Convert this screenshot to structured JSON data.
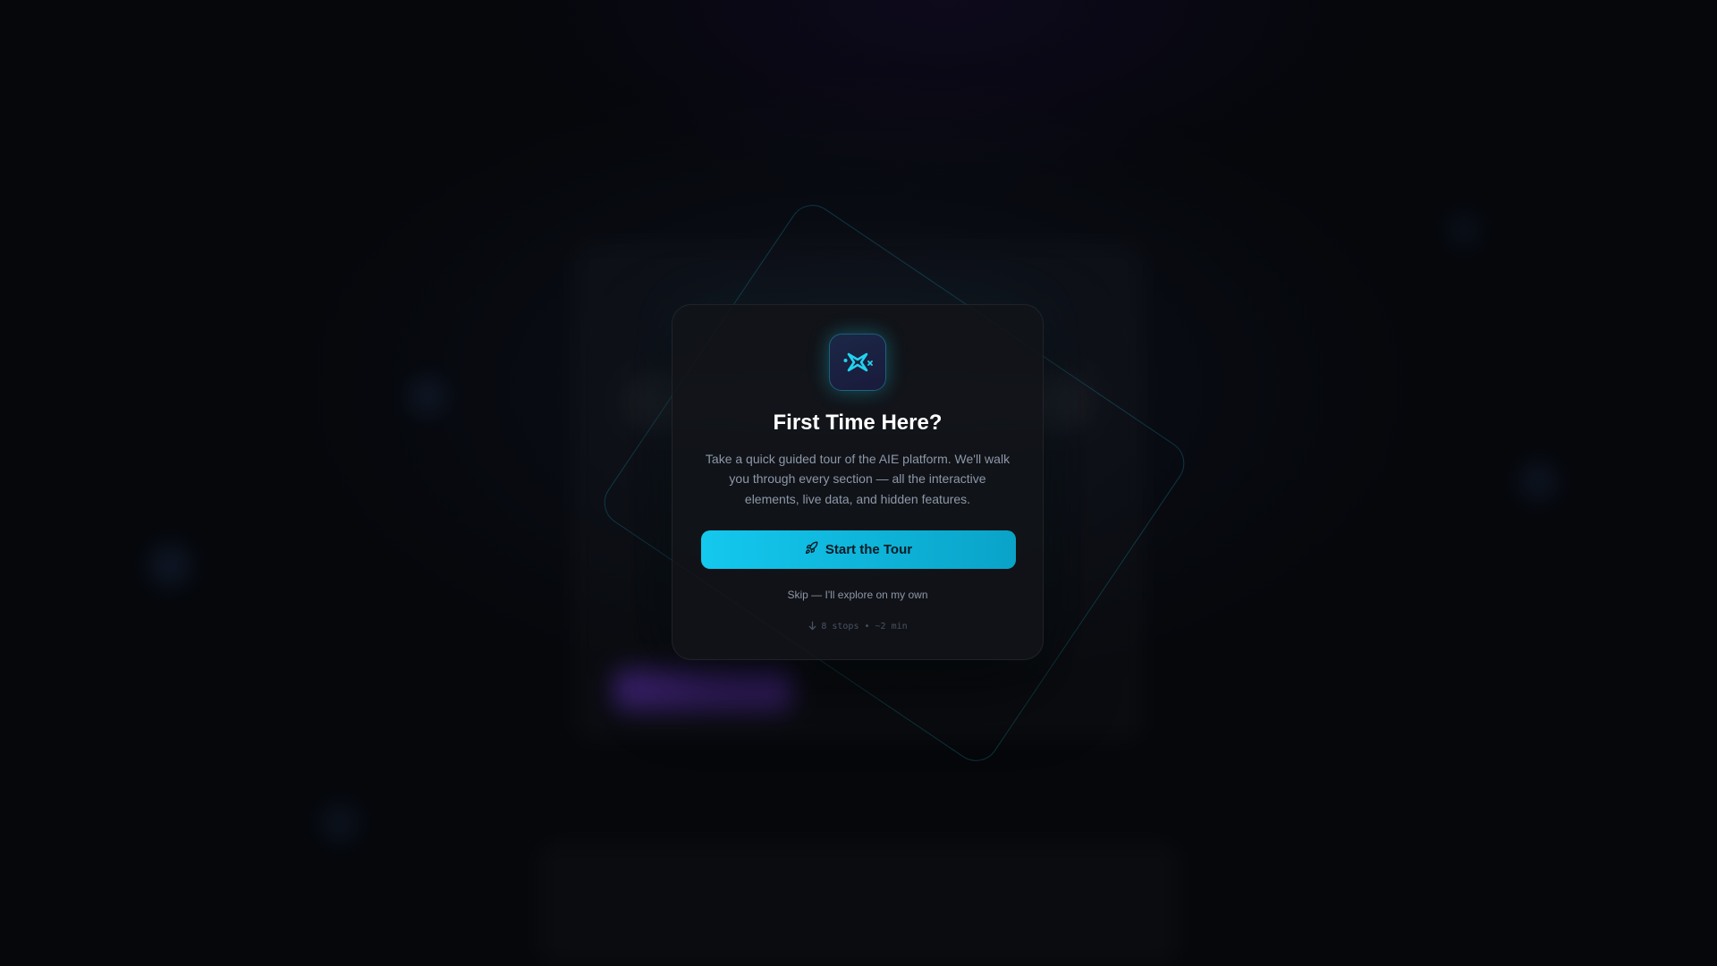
{
  "modal": {
    "icon": "sparkle-icon",
    "title": "First Time Here?",
    "description": "Take a quick guided tour of the AIE platform. We'll walk you through every section — all the interactive elements, live data, and hidden features.",
    "start_button": {
      "icon": "rocket-icon",
      "label": "Start the Tour"
    },
    "skip_label": "Skip — I'll explore on my own",
    "meta": {
      "icon": "arrow-down-icon",
      "text": "8 stops • ~2 min"
    }
  },
  "colors": {
    "accent": "#14c8ee",
    "background": "#05070b",
    "card": "#111318",
    "ghost_pill": "#7a3ce6"
  }
}
